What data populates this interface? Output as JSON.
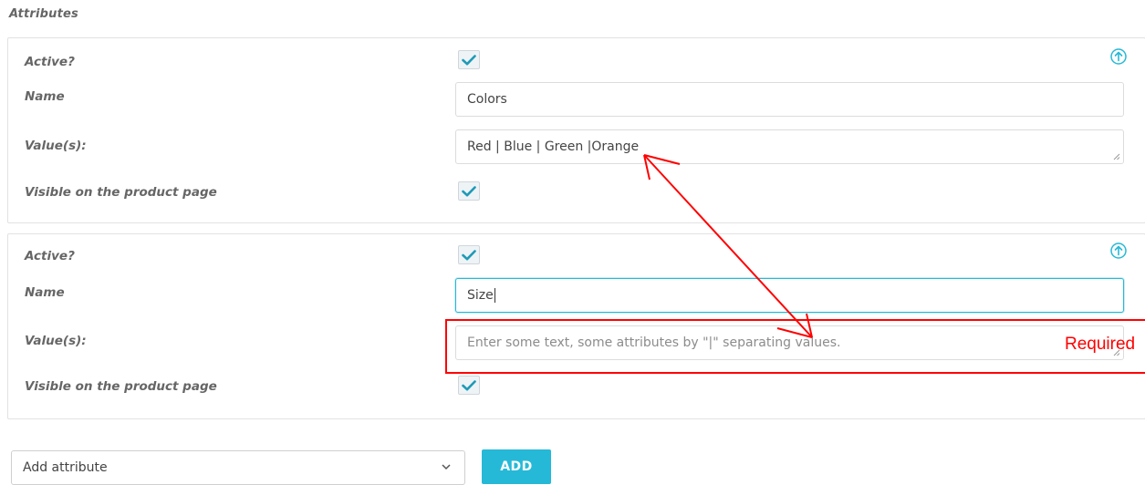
{
  "section": {
    "title": "Attributes"
  },
  "attributes": [
    {
      "active_label": "Active?",
      "active_checked": true,
      "name_label": "Name",
      "name_value": "Colors",
      "values_label": "Value(s):",
      "values_value": "Red | Blue | Green |Orange",
      "visible_label": "Visible on the product page",
      "visible_checked": true
    },
    {
      "active_label": "Active?",
      "active_checked": true,
      "name_label": "Name",
      "name_value": "Size",
      "values_label": "Value(s):",
      "values_placeholder": "Enter some text, some attributes by \"|\" separating values.",
      "visible_label": "Visible on the product page",
      "visible_checked": true
    }
  ],
  "footer": {
    "select_value": "Add attribute",
    "add_button_label": "ADD"
  },
  "annotation": {
    "required_text": "Required",
    "color": "#ff0000"
  },
  "colors": {
    "accent": "#25b9d7",
    "checkbox_bg": "#eef3f6"
  },
  "icons": [
    "checkbox-checked-icon",
    "collapse-up-icon",
    "chevron-down-icon",
    "resize-handle-icon"
  ]
}
